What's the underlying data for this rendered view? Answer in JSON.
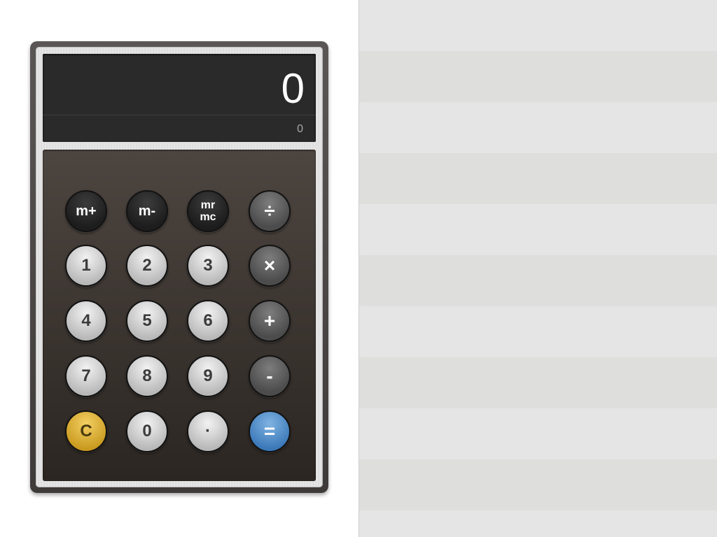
{
  "display": {
    "main_value": "0",
    "memory_value": "0"
  },
  "keys": {
    "mem_plus": "m+",
    "mem_minus": "m-",
    "mem_recall": "mr",
    "mem_clear": "mc",
    "divide": "÷",
    "multiply": "×",
    "plus": "+",
    "minus": "-",
    "equals": "=",
    "clear": "C",
    "decimal": "·",
    "d0": "0",
    "d1": "1",
    "d2": "2",
    "d3": "3",
    "d4": "4",
    "d5": "5",
    "d6": "6",
    "d7": "7",
    "d8": "8",
    "d9": "9"
  },
  "colors": {
    "clear_key": "#d9ad3a",
    "equals_key": "#4f8bc8",
    "display_bg": "#2b2a2a",
    "keypad_bg": "#3a332e"
  }
}
